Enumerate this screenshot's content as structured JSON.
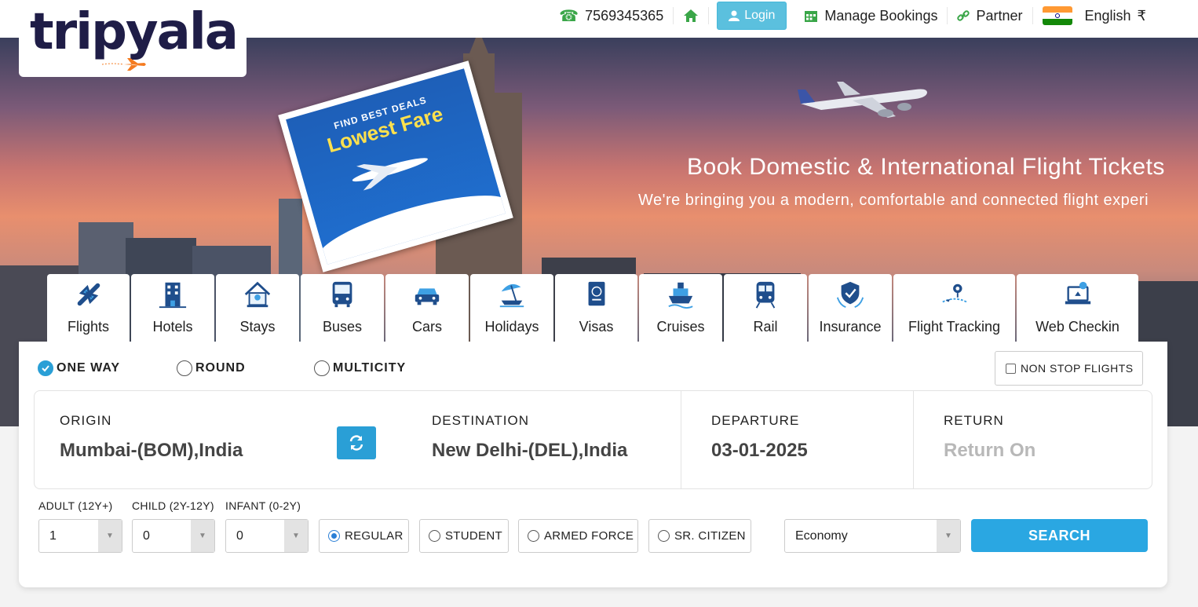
{
  "brand": {
    "name": "tripyala"
  },
  "topnav": {
    "phone": "7569345365",
    "login": "Login",
    "manage_bookings": "Manage Bookings",
    "partner": "Partner",
    "language": "English",
    "currency": "₹"
  },
  "hero": {
    "promo_small": "FIND BEST DEALS",
    "promo_big": "Lowest Fare",
    "title": "Book Domestic & International Flight Tickets",
    "subtitle": "We're bringing you a modern, comfortable and connected flight experi"
  },
  "services": [
    {
      "label": "Flights",
      "icon": "plane-icon"
    },
    {
      "label": "Hotels",
      "icon": "hotel-icon"
    },
    {
      "label": "Stays",
      "icon": "house-icon"
    },
    {
      "label": "Buses",
      "icon": "bus-icon"
    },
    {
      "label": "Cars",
      "icon": "car-icon"
    },
    {
      "label": "Holidays",
      "icon": "beach-icon"
    },
    {
      "label": "Visas",
      "icon": "passport-icon"
    },
    {
      "label": "Cruises",
      "icon": "ship-icon"
    },
    {
      "label": "Rail",
      "icon": "train-icon"
    },
    {
      "label": "Insurance",
      "icon": "shield-hand-icon"
    },
    {
      "label": "Flight Tracking",
      "icon": "tracking-icon"
    },
    {
      "label": "Web Checkin",
      "icon": "laptop-checkin-icon"
    }
  ],
  "search": {
    "trip_types": [
      "ONE WAY",
      "ROUND",
      "MULTICITY"
    ],
    "selected_trip_type": "ONE WAY",
    "non_stop": "NON STOP FLIGHTS",
    "origin_label": "ORIGIN",
    "origin_value": "Mumbai-(BOM),India",
    "destination_label": "DESTINATION",
    "destination_value": "New Delhi-(DEL),India",
    "departure_label": "DEPARTURE",
    "departure_value": "03-01-2025",
    "return_label": "RETURN",
    "return_placeholder": "Return On",
    "adult_label": "ADULT (12Y+)",
    "adult_value": "1",
    "child_label": "CHILD (2Y-12Y)",
    "child_value": "0",
    "infant_label": "INFANT (0-2Y)",
    "infant_value": "0",
    "fare_types": [
      "REGULAR",
      "STUDENT",
      "ARMED FORCE",
      "SR. CITIZEN"
    ],
    "selected_fare": "REGULAR",
    "cabin_class": "Economy",
    "search_button": "SEARCH"
  },
  "colors": {
    "accent": "#2aa7e2",
    "login": "#5bc0de",
    "brand_dark": "#1f1d47",
    "icon_blue": "#1f4e8c"
  }
}
